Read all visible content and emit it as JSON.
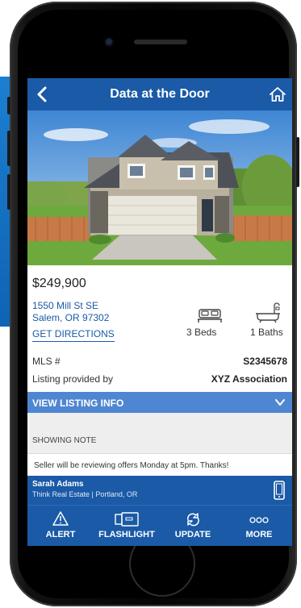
{
  "header": {
    "title": "Data at the Door"
  },
  "listing": {
    "price": "$249,900",
    "address_line1": "1550 Mill St SE",
    "address_line2": "Salem, OR 97302",
    "directions_label": "GET DIRECTIONS",
    "beds": "3 Beds",
    "baths": "1 Baths",
    "mls_label": "MLS #",
    "mls_value": "S2345678",
    "provider_label": "Listing provided by",
    "provider_value": "XYZ Association"
  },
  "view_listing": {
    "label": "VIEW LISTING INFO"
  },
  "showing_note": {
    "heading": "SHOWING NOTE",
    "text": "Seller will be reviewing offers Monday at 5pm. Thanks!"
  },
  "agent": {
    "name": "Sarah Adams",
    "company": "Think Real Estate | Portland, OR"
  },
  "nav": {
    "items": [
      {
        "label": "ALERT",
        "icon": "alert-icon"
      },
      {
        "label": "FLASHLIGHT",
        "icon": "flashlight-icon"
      },
      {
        "label": "UPDATE",
        "icon": "update-icon"
      },
      {
        "label": "MORE",
        "icon": "more-icon"
      }
    ]
  },
  "colors": {
    "primary": "#1a5aa6",
    "accent_bar": "#4f86d1",
    "link": "#1a5aa6"
  }
}
